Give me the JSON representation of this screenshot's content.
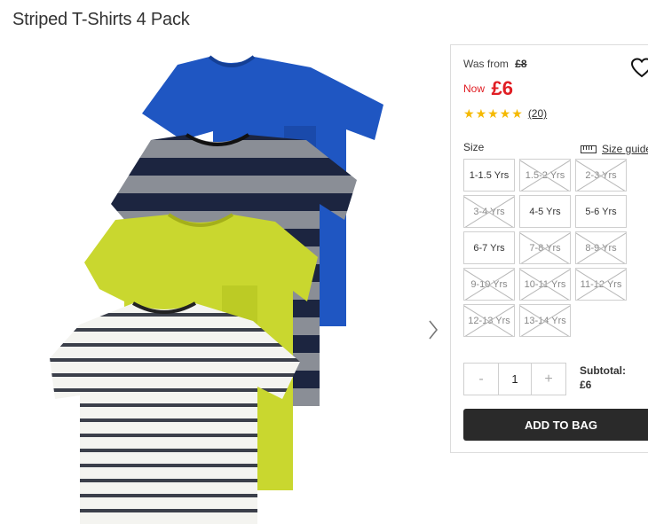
{
  "product": {
    "title": "Striped T-Shirts 4 Pack"
  },
  "price": {
    "was_label": "Was from",
    "was_value": "£8",
    "now_label": "Now",
    "now_value": "£6",
    "accent_color": "#e01e24"
  },
  "rating": {
    "stars": 5,
    "max_stars": 5,
    "reviews": "(20)",
    "star_color": "#f5b900"
  },
  "size": {
    "label": "Size",
    "guide_label": "Size guide",
    "options": [
      {
        "label": "1-1.5 Yrs",
        "available": true
      },
      {
        "label": "1.5-2 Yrs",
        "available": false
      },
      {
        "label": "2-3 Yrs",
        "available": false
      },
      {
        "label": "3-4 Yrs",
        "available": false
      },
      {
        "label": "4-5 Yrs",
        "available": true
      },
      {
        "label": "5-6 Yrs",
        "available": true
      },
      {
        "label": "6-7 Yrs",
        "available": true
      },
      {
        "label": "7-8 Yrs",
        "available": false
      },
      {
        "label": "8-9 Yrs",
        "available": false
      },
      {
        "label": "9-10 Yrs",
        "available": false
      },
      {
        "label": "10-11 Yrs",
        "available": false
      },
      {
        "label": "11-12 Yrs",
        "available": false
      },
      {
        "label": "12-13 Yrs",
        "available": false
      },
      {
        "label": "13-14 Yrs",
        "available": false
      }
    ]
  },
  "quantity": {
    "minus": "-",
    "value": "1",
    "plus": "+"
  },
  "subtotal": {
    "label": "Subtotal:",
    "value": "£6"
  },
  "cart": {
    "add_label": "ADD TO BAG"
  },
  "icons": {
    "wishlist": "heart-icon",
    "next": "chevron-right-icon",
    "size_guide": "ruler-icon",
    "star": "star-icon"
  },
  "colors": {
    "button_bg": "#2a2a2a",
    "tee_blue": "#1f56c2",
    "tee_navy": "#1c2540",
    "tee_lime": "#c9d72f"
  }
}
